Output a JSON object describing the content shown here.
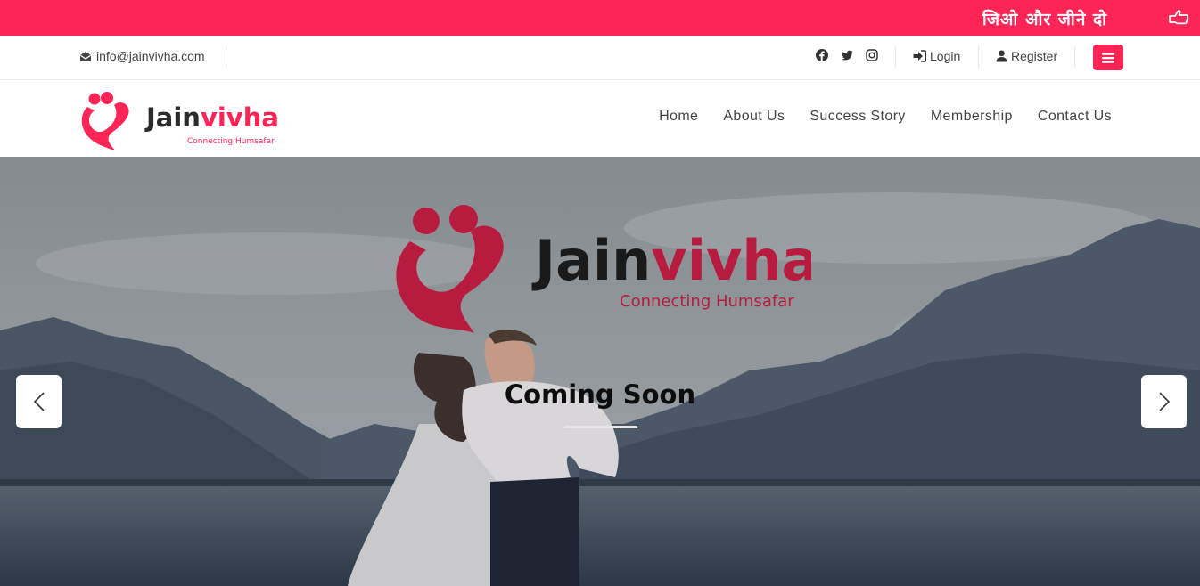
{
  "ribbon": {
    "slogan": "जिओ और जीने दो",
    "icon": "hand-point-right-icon",
    "color": "#fd2456"
  },
  "infobar": {
    "email": "info@jainvivha.com",
    "social": [
      "facebook-icon",
      "twitter-icon",
      "instagram-icon"
    ],
    "login_label": "Login",
    "register_label": "Register",
    "menu_icon": "hamburger-icon"
  },
  "brand": {
    "name_part1": "Jain",
    "name_part2": "vivha",
    "tagline": "Connecting Humsafar",
    "accent": "#fd2456"
  },
  "nav": {
    "items": [
      {
        "label": "Home"
      },
      {
        "label": "About Us"
      },
      {
        "label": "Success Story"
      },
      {
        "label": "Membership"
      },
      {
        "label": "Contact Us"
      }
    ]
  },
  "hero": {
    "heading": "Coming Soon",
    "prev_icon": "chevron-left-icon",
    "next_icon": "chevron-right-icon"
  }
}
